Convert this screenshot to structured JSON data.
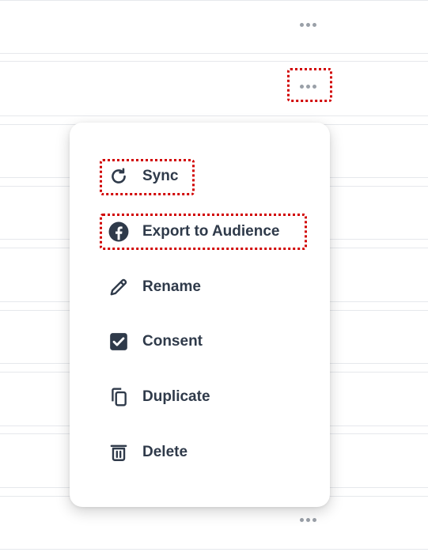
{
  "table": {
    "more_button_glyph": "•••"
  },
  "context_menu": {
    "items": [
      {
        "label": "Sync",
        "icon": "sync-icon"
      },
      {
        "label": "Export to Audience",
        "icon": "facebook-icon"
      },
      {
        "label": "Rename",
        "icon": "pencil-icon"
      },
      {
        "label": "Consent",
        "icon": "checkbox-checked-icon"
      },
      {
        "label": "Duplicate",
        "icon": "duplicate-icon"
      },
      {
        "label": "Delete",
        "icon": "trash-icon"
      }
    ]
  },
  "colors": {
    "text": "#2f3a4a",
    "icon": "#2f3a4a",
    "divider": "#e6e8ec",
    "highlight": "#d10000"
  }
}
